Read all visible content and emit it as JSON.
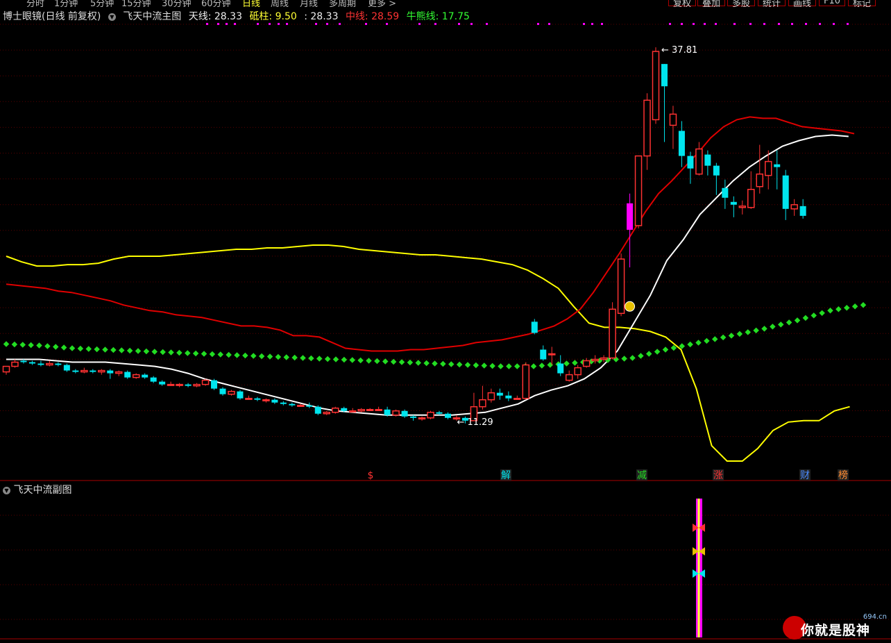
{
  "topbar": {
    "periods": [
      "分时",
      "1分钟",
      "5分钟",
      "15分钟",
      "30分钟",
      "60分钟",
      "日线",
      "周线",
      "月线",
      "多周期",
      "更多 >"
    ],
    "active_index": 6,
    "buttons": [
      "复权",
      "叠加",
      "多股",
      "统计",
      "画线",
      "F10",
      "标记"
    ]
  },
  "header": {
    "title": "博士眼镜(日线 前复权)",
    "indicator": "飞天中流主图",
    "tianxian_label": "天线: 28.33",
    "dizhu_label": "砥柱: 9.50",
    "colon_value": ": 28.33",
    "zhongxian_label": "中线: 28.59",
    "niuxiong_label": "牛熊线: 17.75"
  },
  "sub_panel": {
    "title": "飞天中流副图"
  },
  "annotations": {
    "high": "37.81",
    "low": "11.29"
  },
  "markers": [
    "$",
    "解",
    "减",
    "涨",
    "财",
    "榜"
  ],
  "logo": {
    "text": "你就是股神",
    "site": "694.cn"
  },
  "colors": {
    "up": "#ff3232",
    "down": "#00e5ee",
    "yellow": "#ffff00",
    "red": "#e00000",
    "white": "#ffffff",
    "green": "#00ff00",
    "magenta": "#ff00ff",
    "grid": "#5a0000"
  },
  "chart_data": {
    "type": "candlestick",
    "ylim": [
      8,
      39
    ],
    "candles": [
      [
        14.5,
        14.9,
        14.9,
        14.3
      ],
      [
        14.9,
        15.2,
        15.4,
        14.8
      ],
      [
        15.3,
        15.2,
        15.4,
        15.1
      ],
      [
        15.2,
        15.1,
        15.3,
        15.0
      ],
      [
        15.1,
        15.0,
        15.3,
        14.9
      ],
      [
        15.0,
        15.1,
        15.3,
        14.9
      ],
      [
        15.1,
        15.0,
        15.2,
        14.9
      ],
      [
        15.0,
        14.6,
        15.1,
        14.5
      ],
      [
        14.6,
        14.5,
        14.7,
        14.4
      ],
      [
        14.5,
        14.6,
        14.8,
        14.4
      ],
      [
        14.6,
        14.5,
        14.7,
        14.4
      ],
      [
        14.5,
        14.6,
        14.7,
        14.3
      ],
      [
        14.6,
        14.4,
        14.7,
        14.0
      ],
      [
        14.4,
        14.5,
        14.6,
        14.2
      ],
      [
        14.5,
        14.1,
        14.6,
        14.0
      ],
      [
        14.1,
        14.3,
        14.4,
        14.0
      ],
      [
        14.3,
        14.1,
        14.4,
        14.0
      ],
      [
        14.1,
        13.8,
        14.2,
        13.7
      ],
      [
        13.8,
        13.6,
        13.9,
        13.5
      ],
      [
        13.6,
        13.6,
        13.8,
        13.5
      ],
      [
        13.6,
        13.6,
        13.7,
        13.4
      ],
      [
        13.6,
        13.5,
        13.7,
        13.4
      ],
      [
        13.5,
        13.6,
        13.7,
        13.4
      ],
      [
        13.6,
        13.9,
        14.0,
        13.5
      ],
      [
        13.9,
        13.3,
        14.0,
        13.2
      ],
      [
        13.3,
        12.9,
        13.4,
        12.8
      ],
      [
        12.9,
        13.1,
        13.2,
        12.8
      ],
      [
        13.1,
        12.6,
        13.2,
        12.5
      ],
      [
        12.6,
        12.6,
        12.8,
        12.5
      ],
      [
        12.6,
        12.5,
        12.7,
        12.4
      ],
      [
        12.5,
        12.5,
        12.6,
        12.3
      ],
      [
        12.5,
        12.3,
        12.6,
        12.2
      ],
      [
        12.3,
        12.2,
        12.4,
        12.1
      ],
      [
        12.2,
        12.1,
        12.3,
        12.0
      ],
      [
        12.1,
        12.1,
        12.2,
        12.0
      ],
      [
        12.1,
        12.0,
        12.3,
        11.9
      ],
      [
        12.0,
        11.5,
        12.1,
        11.4
      ],
      [
        11.5,
        11.6,
        11.7,
        11.4
      ],
      [
        11.6,
        11.9,
        12.0,
        11.5
      ],
      [
        11.9,
        11.7,
        12.0,
        11.6
      ],
      [
        11.7,
        11.7,
        11.9,
        11.6
      ],
      [
        11.7,
        11.8,
        11.9,
        11.6
      ],
      [
        11.8,
        11.8,
        11.9,
        11.7
      ],
      [
        11.8,
        11.8,
        12.0,
        11.7
      ],
      [
        11.8,
        11.4,
        12.0,
        11.3
      ],
      [
        11.4,
        11.7,
        11.8,
        11.3
      ],
      [
        11.7,
        11.3,
        11.8,
        11.2
      ],
      [
        11.3,
        11.2,
        11.4,
        11.0
      ],
      [
        11.2,
        11.2,
        11.3,
        11.0
      ],
      [
        11.2,
        11.6,
        11.7,
        11.1
      ],
      [
        11.6,
        11.5,
        11.7,
        11.4
      ],
      [
        11.5,
        11.2,
        11.6,
        11.1
      ],
      [
        11.2,
        11.2,
        11.4,
        11.0
      ],
      [
        11.2,
        11.0,
        11.3,
        10.8
      ],
      [
        11.0,
        12.0,
        13.0,
        11.0
      ],
      [
        12.0,
        12.5,
        13.5,
        11.8
      ],
      [
        12.5,
        13.0,
        13.3,
        12.3
      ],
      [
        13.0,
        12.8,
        13.3,
        12.5
      ],
      [
        12.8,
        12.6,
        13.1,
        12.4
      ],
      [
        12.6,
        12.6,
        12.8,
        12.5
      ],
      [
        12.6,
        15.0,
        15.2,
        12.5
      ],
      [
        18.1,
        17.3,
        18.3,
        17.2
      ],
      [
        16.1,
        15.4,
        16.4,
        15.3
      ],
      [
        15.8,
        15.8,
        16.3,
        15.0
      ],
      [
        15.1,
        14.4,
        15.7,
        14.2
      ],
      [
        13.9,
        14.3,
        14.6,
        13.8
      ],
      [
        14.3,
        14.8,
        15.0,
        14.0
      ],
      [
        14.9,
        15.3,
        15.5,
        14.8
      ],
      [
        15.3,
        15.4,
        15.7,
        15.1
      ],
      [
        15.4,
        15.5,
        15.7,
        15.2
      ],
      [
        15.5,
        19.0,
        19.5,
        15.4
      ],
      [
        18.7,
        22.6,
        23.0,
        18.5
      ],
      [
        26.6,
        24.7,
        27.3,
        22.0
      ],
      [
        25.0,
        30.0,
        30.0,
        24.8
      ],
      [
        30.0,
        34.0,
        34.5,
        29.0
      ],
      [
        32.6,
        37.5,
        37.8,
        32.3
      ],
      [
        36.6,
        35.0,
        36.6,
        31.0
      ],
      [
        32.2,
        33.0,
        33.6,
        30.5
      ],
      [
        31.8,
        30.0,
        32.5,
        29.2
      ],
      [
        30.0,
        29.1,
        30.3,
        28.0
      ],
      [
        28.7,
        30.5,
        31.0,
        28.6
      ],
      [
        30.1,
        29.3,
        30.4,
        28.6
      ],
      [
        29.3,
        28.6,
        29.5,
        27.2
      ],
      [
        27.7,
        27.0,
        28.3,
        26.2
      ],
      [
        26.7,
        26.5,
        27.1,
        25.6
      ],
      [
        26.3,
        26.4,
        26.8,
        25.8
      ],
      [
        26.3,
        27.6,
        28.9,
        26.2
      ],
      [
        27.8,
        28.7,
        30.8,
        27.3
      ],
      [
        28.6,
        29.6,
        30.4,
        27.6
      ],
      [
        29.4,
        29.2,
        30.4,
        27.6
      ],
      [
        28.6,
        26.2,
        29.0,
        25.4
      ],
      [
        26.2,
        26.5,
        26.9,
        25.7
      ],
      [
        26.4,
        25.7,
        26.9,
        25.5
      ]
    ],
    "yellow": [
      22.8,
      22.4,
      22.1,
      22.1,
      22.2,
      22.2,
      22.3,
      22.6,
      22.8,
      22.8,
      22.8,
      22.9,
      23.0,
      23.1,
      23.2,
      23.3,
      23.3,
      23.4,
      23.4,
      23.5,
      23.6,
      23.6,
      23.5,
      23.3,
      23.2,
      23.1,
      23.0,
      22.9,
      22.9,
      22.8,
      22.7,
      22.6,
      22.4,
      22.2,
      21.8,
      21.2,
      20.5,
      19.2,
      18.0,
      17.7,
      17.7,
      17.6,
      17.4,
      17.0,
      16.1,
      13.3,
      9.2,
      8.1,
      8.1,
      9.0,
      10.3,
      10.9,
      11.0,
      11.0,
      11.7,
      12.0
    ],
    "red": [
      20.8,
      20.7,
      20.6,
      20.5,
      20.3,
      20.2,
      20.0,
      19.8,
      19.6,
      19.3,
      19.1,
      18.9,
      18.8,
      18.6,
      18.5,
      18.4,
      18.2,
      18.0,
      17.8,
      17.8,
      17.7,
      17.5,
      17.1,
      17.1,
      17.0,
      16.6,
      16.2,
      16.1,
      16.0,
      16.0,
      16.0,
      16.1,
      16.1,
      16.2,
      16.3,
      16.4,
      16.6,
      16.7,
      16.8,
      17.0,
      17.2,
      17.5,
      17.8,
      18.3,
      19.0,
      20.2,
      21.6,
      23.0,
      24.5,
      26.0,
      27.3,
      28.2,
      29.2,
      30.2,
      31.3,
      32.1,
      32.6,
      32.8,
      32.7,
      32.7,
      32.4,
      32.1,
      32.0,
      31.9,
      31.8,
      31.6
    ],
    "white": [
      15.4,
      15.4,
      15.4,
      15.3,
      15.2,
      15.2,
      15.2,
      15.1,
      15.0,
      14.9,
      14.7,
      14.4,
      14.0,
      13.7,
      13.4,
      13.1,
      12.8,
      12.5,
      12.2,
      11.9,
      11.7,
      11.6,
      11.5,
      11.4,
      11.4,
      11.4,
      11.4,
      11.4,
      11.5,
      11.6,
      11.9,
      12.2,
      12.8,
      13.2,
      13.5,
      14.0,
      14.8,
      16.0,
      18.0,
      20.0,
      22.5,
      24.0,
      25.8,
      27.0,
      28.2,
      29.2,
      30.0,
      30.7,
      31.1,
      31.4,
      31.5,
      31.4
    ],
    "green": [
      16.5,
      16.4,
      16.2,
      16.1,
      16.0,
      15.9,
      15.8,
      15.7,
      15.6,
      15.5,
      15.4,
      15.3,
      15.2,
      15.1,
      15.0,
      14.9,
      14.9,
      15.1,
      15.3,
      15.5,
      16.1,
      16.6,
      17.1,
      17.6,
      18.2,
      18.9,
      19.3
    ],
    "hi_marker_index": 75,
    "lo_marker_index": 53
  }
}
